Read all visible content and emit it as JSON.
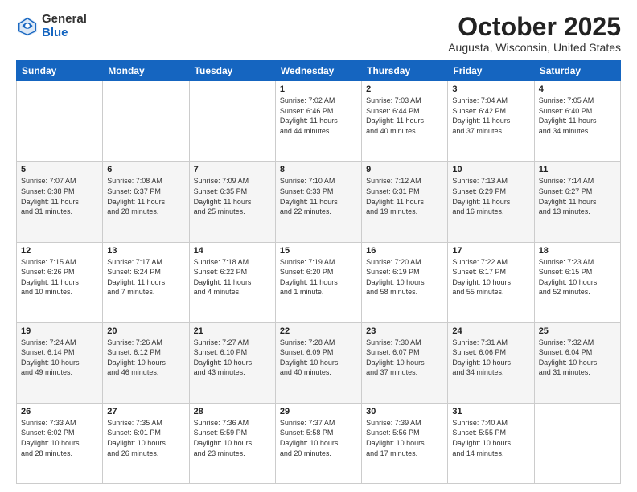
{
  "header": {
    "logo_general": "General",
    "logo_blue": "Blue",
    "month_title": "October 2025",
    "location": "Augusta, Wisconsin, United States"
  },
  "days_of_week": [
    "Sunday",
    "Monday",
    "Tuesday",
    "Wednesday",
    "Thursday",
    "Friday",
    "Saturday"
  ],
  "weeks": [
    [
      {
        "num": "",
        "info": ""
      },
      {
        "num": "",
        "info": ""
      },
      {
        "num": "",
        "info": ""
      },
      {
        "num": "1",
        "info": "Sunrise: 7:02 AM\nSunset: 6:46 PM\nDaylight: 11 hours\nand 44 minutes."
      },
      {
        "num": "2",
        "info": "Sunrise: 7:03 AM\nSunset: 6:44 PM\nDaylight: 11 hours\nand 40 minutes."
      },
      {
        "num": "3",
        "info": "Sunrise: 7:04 AM\nSunset: 6:42 PM\nDaylight: 11 hours\nand 37 minutes."
      },
      {
        "num": "4",
        "info": "Sunrise: 7:05 AM\nSunset: 6:40 PM\nDaylight: 11 hours\nand 34 minutes."
      }
    ],
    [
      {
        "num": "5",
        "info": "Sunrise: 7:07 AM\nSunset: 6:38 PM\nDaylight: 11 hours\nand 31 minutes."
      },
      {
        "num": "6",
        "info": "Sunrise: 7:08 AM\nSunset: 6:37 PM\nDaylight: 11 hours\nand 28 minutes."
      },
      {
        "num": "7",
        "info": "Sunrise: 7:09 AM\nSunset: 6:35 PM\nDaylight: 11 hours\nand 25 minutes."
      },
      {
        "num": "8",
        "info": "Sunrise: 7:10 AM\nSunset: 6:33 PM\nDaylight: 11 hours\nand 22 minutes."
      },
      {
        "num": "9",
        "info": "Sunrise: 7:12 AM\nSunset: 6:31 PM\nDaylight: 11 hours\nand 19 minutes."
      },
      {
        "num": "10",
        "info": "Sunrise: 7:13 AM\nSunset: 6:29 PM\nDaylight: 11 hours\nand 16 minutes."
      },
      {
        "num": "11",
        "info": "Sunrise: 7:14 AM\nSunset: 6:27 PM\nDaylight: 11 hours\nand 13 minutes."
      }
    ],
    [
      {
        "num": "12",
        "info": "Sunrise: 7:15 AM\nSunset: 6:26 PM\nDaylight: 11 hours\nand 10 minutes."
      },
      {
        "num": "13",
        "info": "Sunrise: 7:17 AM\nSunset: 6:24 PM\nDaylight: 11 hours\nand 7 minutes."
      },
      {
        "num": "14",
        "info": "Sunrise: 7:18 AM\nSunset: 6:22 PM\nDaylight: 11 hours\nand 4 minutes."
      },
      {
        "num": "15",
        "info": "Sunrise: 7:19 AM\nSunset: 6:20 PM\nDaylight: 11 hours\nand 1 minute."
      },
      {
        "num": "16",
        "info": "Sunrise: 7:20 AM\nSunset: 6:19 PM\nDaylight: 10 hours\nand 58 minutes."
      },
      {
        "num": "17",
        "info": "Sunrise: 7:22 AM\nSunset: 6:17 PM\nDaylight: 10 hours\nand 55 minutes."
      },
      {
        "num": "18",
        "info": "Sunrise: 7:23 AM\nSunset: 6:15 PM\nDaylight: 10 hours\nand 52 minutes."
      }
    ],
    [
      {
        "num": "19",
        "info": "Sunrise: 7:24 AM\nSunset: 6:14 PM\nDaylight: 10 hours\nand 49 minutes."
      },
      {
        "num": "20",
        "info": "Sunrise: 7:26 AM\nSunset: 6:12 PM\nDaylight: 10 hours\nand 46 minutes."
      },
      {
        "num": "21",
        "info": "Sunrise: 7:27 AM\nSunset: 6:10 PM\nDaylight: 10 hours\nand 43 minutes."
      },
      {
        "num": "22",
        "info": "Sunrise: 7:28 AM\nSunset: 6:09 PM\nDaylight: 10 hours\nand 40 minutes."
      },
      {
        "num": "23",
        "info": "Sunrise: 7:30 AM\nSunset: 6:07 PM\nDaylight: 10 hours\nand 37 minutes."
      },
      {
        "num": "24",
        "info": "Sunrise: 7:31 AM\nSunset: 6:06 PM\nDaylight: 10 hours\nand 34 minutes."
      },
      {
        "num": "25",
        "info": "Sunrise: 7:32 AM\nSunset: 6:04 PM\nDaylight: 10 hours\nand 31 minutes."
      }
    ],
    [
      {
        "num": "26",
        "info": "Sunrise: 7:33 AM\nSunset: 6:02 PM\nDaylight: 10 hours\nand 28 minutes."
      },
      {
        "num": "27",
        "info": "Sunrise: 7:35 AM\nSunset: 6:01 PM\nDaylight: 10 hours\nand 26 minutes."
      },
      {
        "num": "28",
        "info": "Sunrise: 7:36 AM\nSunset: 5:59 PM\nDaylight: 10 hours\nand 23 minutes."
      },
      {
        "num": "29",
        "info": "Sunrise: 7:37 AM\nSunset: 5:58 PM\nDaylight: 10 hours\nand 20 minutes."
      },
      {
        "num": "30",
        "info": "Sunrise: 7:39 AM\nSunset: 5:56 PM\nDaylight: 10 hours\nand 17 minutes."
      },
      {
        "num": "31",
        "info": "Sunrise: 7:40 AM\nSunset: 5:55 PM\nDaylight: 10 hours\nand 14 minutes."
      },
      {
        "num": "",
        "info": ""
      }
    ]
  ]
}
